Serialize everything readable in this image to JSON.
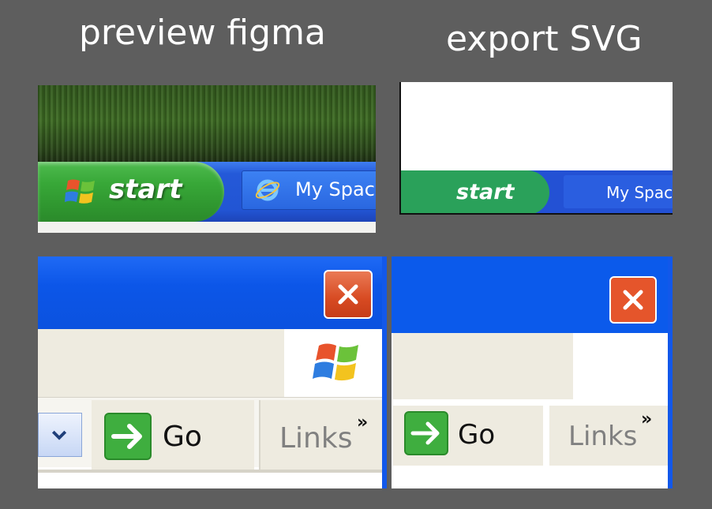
{
  "headings": {
    "left": "preview figma",
    "right": "export SVG"
  },
  "preview_taskbar": {
    "start_label": "start",
    "task_label": "My Space"
  },
  "export_taskbar": {
    "start_label": "start",
    "task_label": "My Space"
  },
  "preview_window": {
    "go_label": "Go",
    "links_label": "Links",
    "chevron": "»"
  },
  "export_window": {
    "go_label": "Go",
    "links_label": "Links",
    "chevron": "»"
  },
  "colors": {
    "background": "#5e5e5e",
    "taskbar_blue": "#2255d4",
    "start_green": "#38a838",
    "titlebar_blue": "#0c56e8",
    "close_red": "#d74a22",
    "go_green": "#3fae3f",
    "toolbar_beige": "#eeebe0"
  },
  "icons": [
    "windows-flag-icon",
    "internet-explorer-icon",
    "close-icon",
    "chevron-down-icon",
    "go-arrow-icon"
  ]
}
